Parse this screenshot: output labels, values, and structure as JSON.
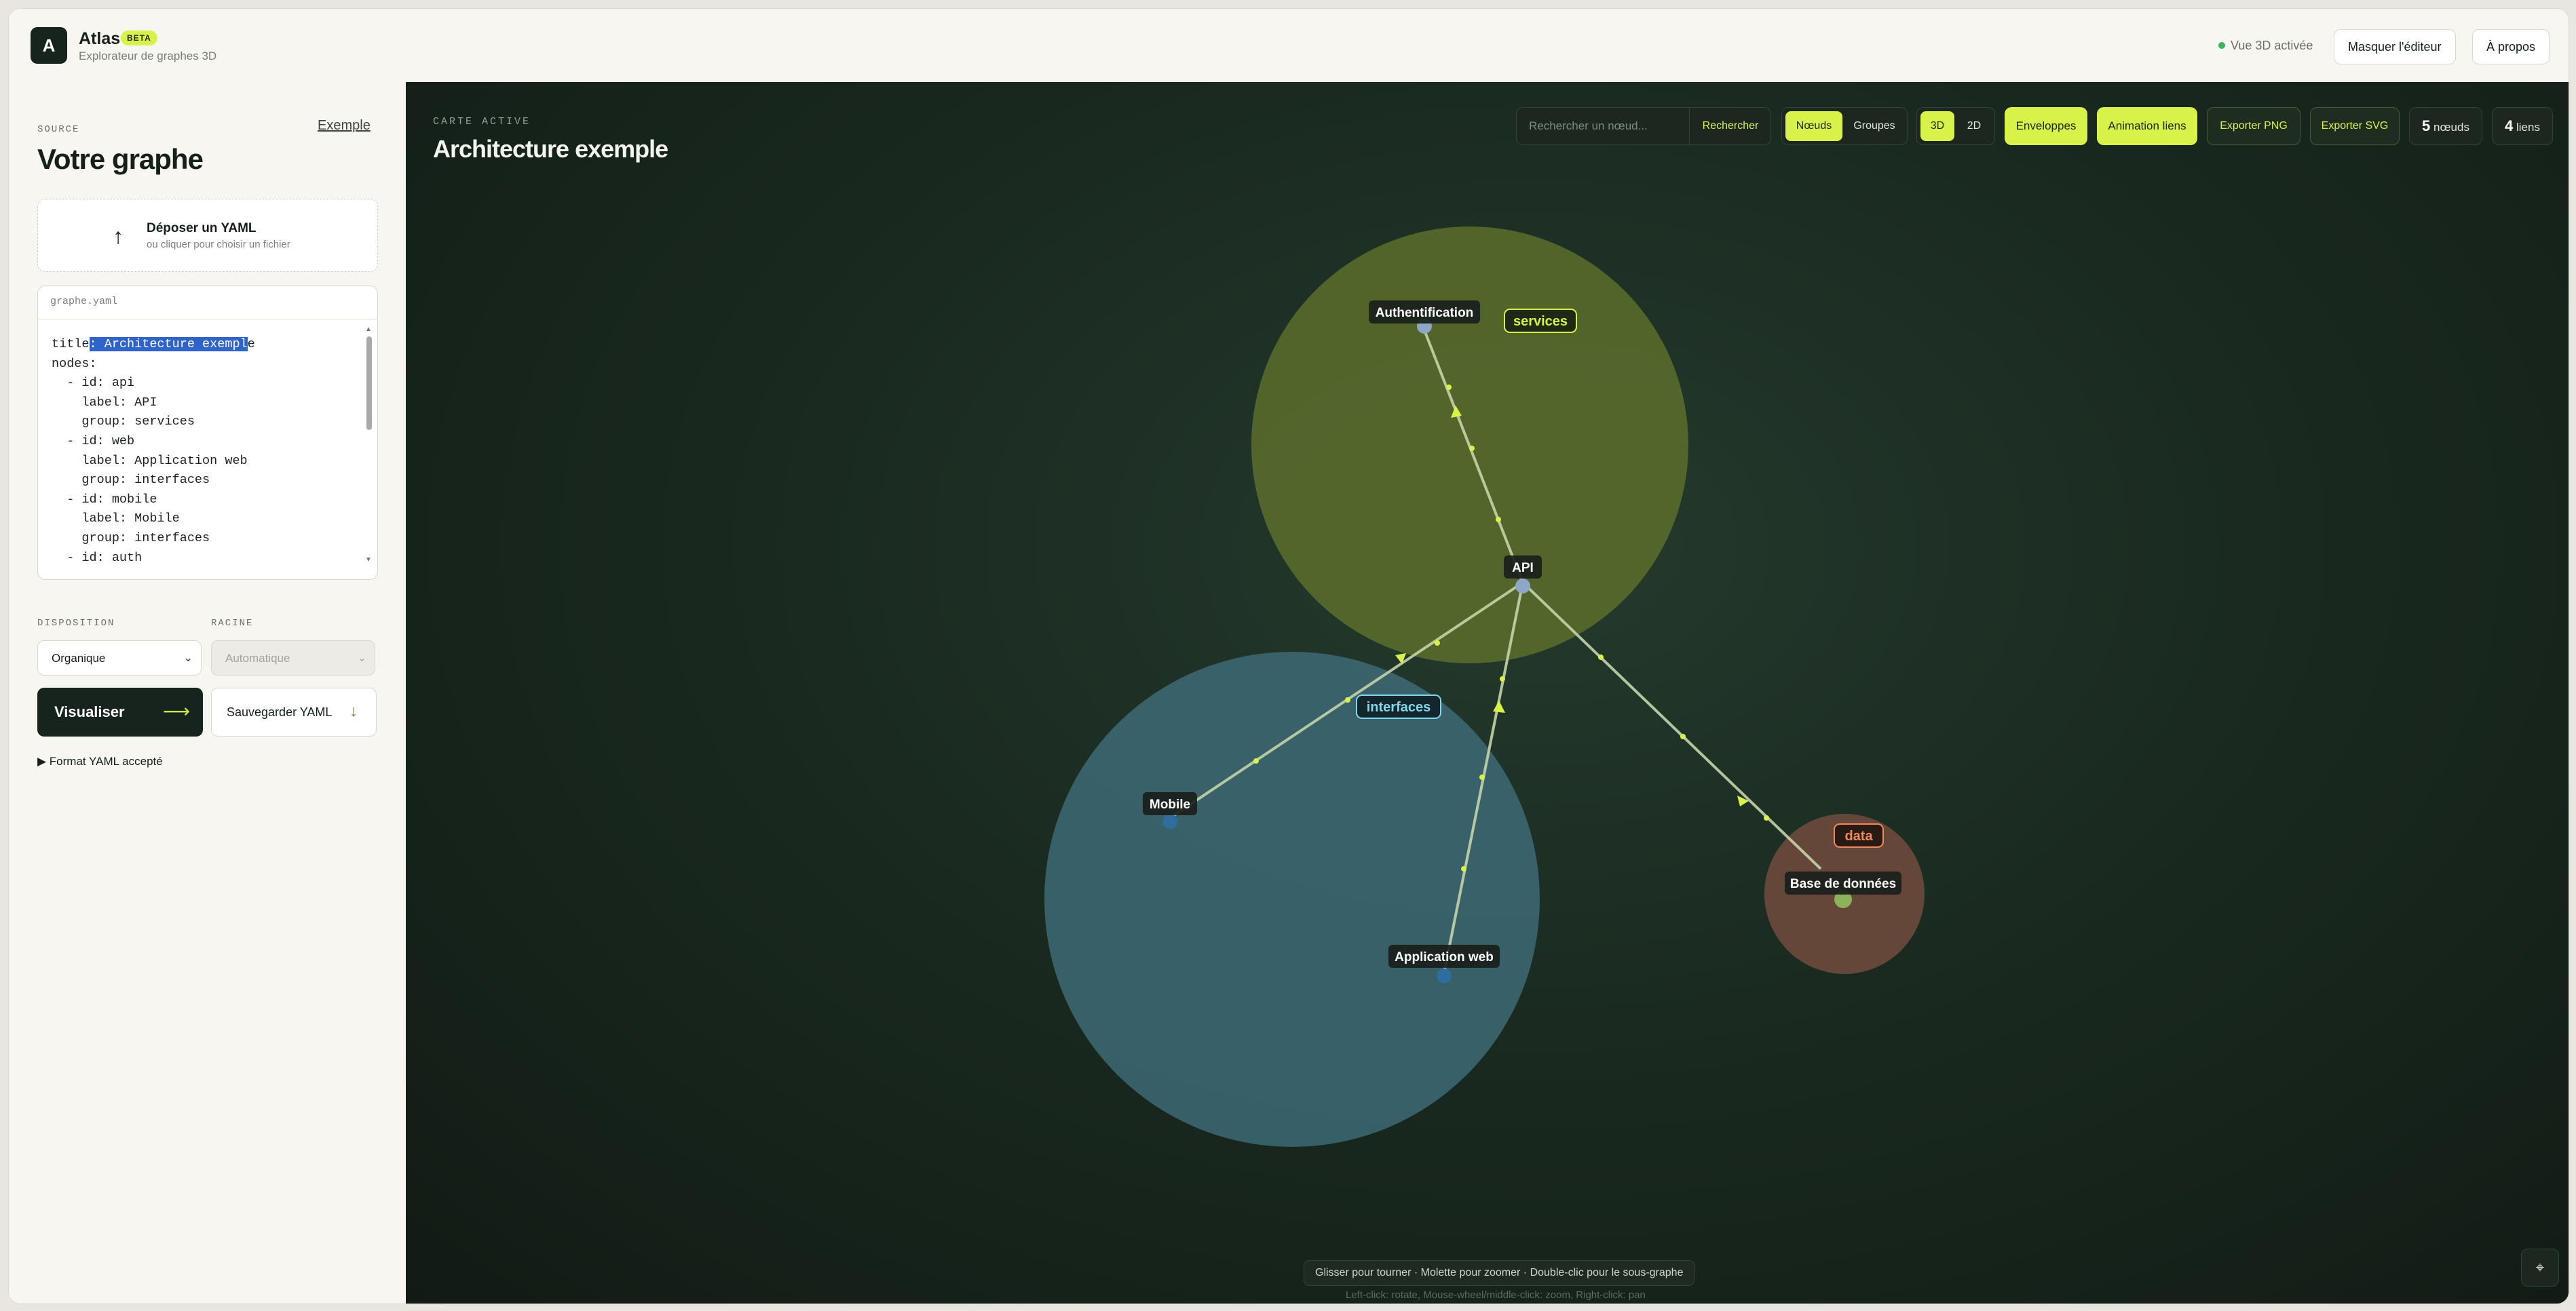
{
  "header": {
    "app_name": "Atlas",
    "badge": "BETA",
    "subtitle": "Explorateur de graphes 3D",
    "status": "Vue 3D activée",
    "hide_editor": "Masquer l'éditeur",
    "about": "À propos"
  },
  "sidebar": {
    "section_label": "SOURCE",
    "example_link": "Exemple",
    "title": "Votre graphe",
    "dropzone": {
      "title": "Déposer un YAML",
      "subtitle": "ou cliquer pour choisir un fichier"
    },
    "editor": {
      "filename": "graphe.yaml",
      "lines": [
        "title: Architecture exemple",
        "nodes:",
        "  - id: api",
        "    label: API",
        "    group: services",
        "  - id: web",
        "    label: Application web",
        "    group: interfaces",
        "  - id: mobile",
        "    label: Mobile",
        "    group: interfaces",
        "  - id: auth"
      ]
    },
    "layout_label": "DISPOSITION",
    "layout_value": "Organique",
    "root_label": "RACINE",
    "root_value": "Automatique",
    "visualize": "Visualiser",
    "save_yaml": "Sauvegarder YAML",
    "yaml_format": "▶ Format YAML accepté"
  },
  "canvas": {
    "active_label": "CARTE ACTIVE",
    "title": "Architecture exemple",
    "search_placeholder": "Rechercher un nœud...",
    "search_button": "Rechercher",
    "mode_nodes": "Nœuds",
    "mode_groups": "Groupes",
    "view_3d": "3D",
    "view_2d": "2D",
    "envelopes": "Enveloppes",
    "link_animation": "Animation liens",
    "export_png": "Exporter PNG",
    "export_svg": "Exporter SVG",
    "node_count": "5",
    "node_word": "nœuds",
    "link_count": "4",
    "link_word": "liens",
    "hint": "Glisser pour tourner · Molette pour zoomer · Double-clic pour le sous-graphe",
    "hint_en": "Left-click: rotate, Mouse-wheel/middle-click: zoom, Right-click: pan",
    "corner_icon": "reset-view-icon"
  },
  "graph": {
    "groups": [
      {
        "name": "services",
        "color": "#5a6f2d",
        "label_color": "#d9f24a"
      },
      {
        "name": "interfaces",
        "color": "#3d6a75",
        "label_color": "#7fd8f0"
      },
      {
        "name": "data",
        "color": "#6e4a3c",
        "label_color": "#f08a5d"
      }
    ],
    "nodes": [
      {
        "id": "auth",
        "label": "Authentification",
        "group": "services"
      },
      {
        "id": "api",
        "label": "API",
        "group": "services"
      },
      {
        "id": "mobile",
        "label": "Mobile",
        "group": "interfaces"
      },
      {
        "id": "web",
        "label": "Application web",
        "group": "interfaces"
      },
      {
        "id": "db",
        "label": "Base de données",
        "group": "data"
      }
    ],
    "links": [
      {
        "from": "api",
        "to": "auth"
      },
      {
        "from": "api",
        "to": "mobile"
      },
      {
        "from": "web",
        "to": "api"
      },
      {
        "from": "api",
        "to": "db"
      }
    ]
  }
}
